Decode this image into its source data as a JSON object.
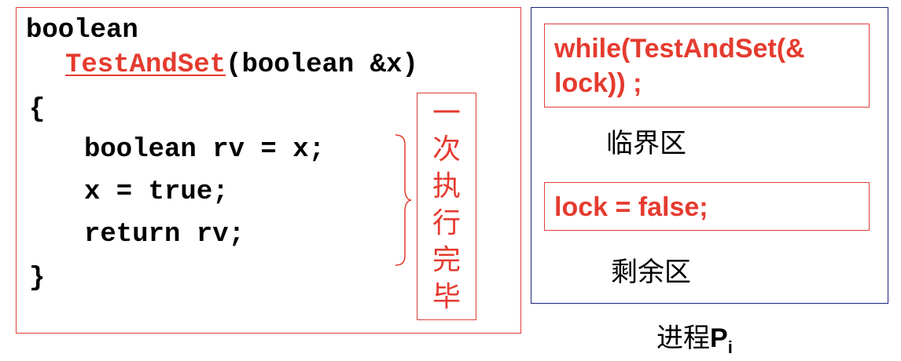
{
  "code": {
    "line1": "boolean",
    "fn_name": "TestAndSet",
    "fn_params": "(boolean &x)",
    "open_brace": "{",
    "body1": "boolean rv = x;",
    "body2": "x = true;",
    "body3": "return rv;",
    "close_brace": "}"
  },
  "annotation": [
    "一",
    "次",
    "执",
    "行",
    "完",
    "毕"
  ],
  "process": {
    "entry": "while(TestAndSet(&\nlock)) ;",
    "critical": "临界区",
    "exit": "lock = false;",
    "remainder": "剩余区",
    "caption_main": "进程",
    "caption_letter": "P",
    "caption_sub": "i"
  },
  "colors": {
    "accent": "#e53b2f",
    "border_red": "#e0403a",
    "border_blue": "#1a237e"
  }
}
